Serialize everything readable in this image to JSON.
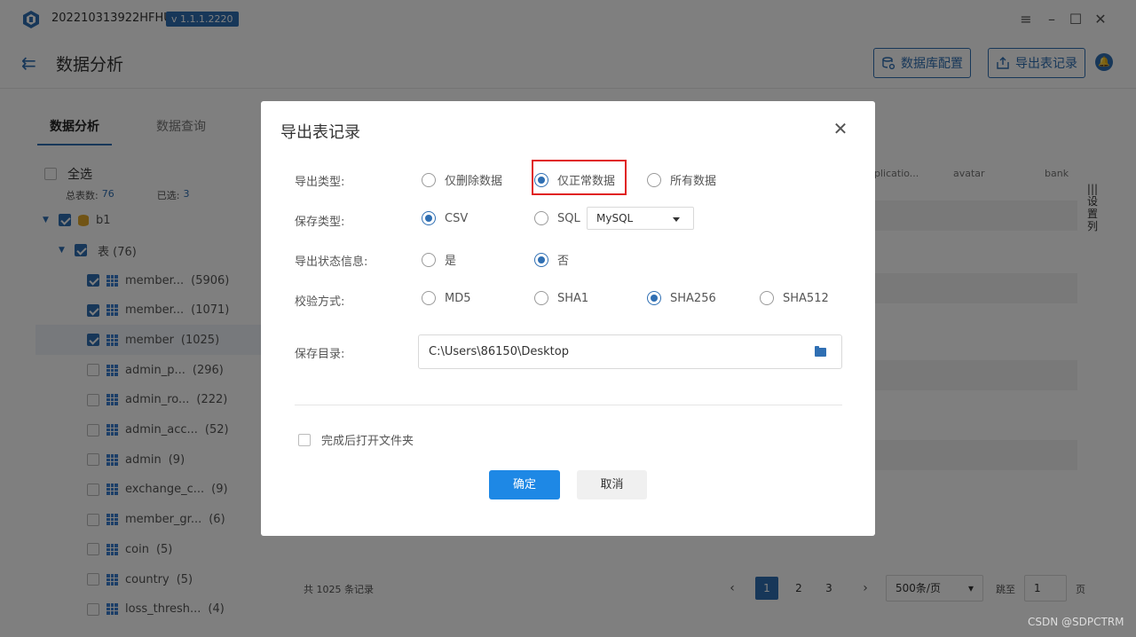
{
  "titlebar": {
    "app_name": "202210313922HFHU",
    "version": "v 1.1.1.2220",
    "menu_icon": "hamburger-icon",
    "minimize_icon": "minimize-icon",
    "maximize_icon": "maximize-icon",
    "close_icon": "close-icon"
  },
  "header": {
    "title": "数据分析",
    "db_config_label": "数据库配置",
    "export_records_label": "导出表记录"
  },
  "left": {
    "tabs": [
      {
        "label": "数据分析"
      },
      {
        "label": "数据查询"
      }
    ],
    "select_all": "全选",
    "total_label": "总表数:",
    "total_value": "76",
    "selected_label": "已选:",
    "selected_value": "3",
    "db_name": "b1",
    "table_group": "表 (76)",
    "tables": [
      {
        "name": "member...",
        "count": "(5906)",
        "checked": true
      },
      {
        "name": "member...",
        "count": "(1071)",
        "checked": true
      },
      {
        "name": "member",
        "count": "(1025)",
        "checked": true
      },
      {
        "name": "admin_p...",
        "count": "(296)",
        "checked": false
      },
      {
        "name": "admin_ro...",
        "count": "(222)",
        "checked": false
      },
      {
        "name": "admin_acc...",
        "count": "(52)",
        "checked": false
      },
      {
        "name": "admin",
        "count": "(9)",
        "checked": false
      },
      {
        "name": "exchange_c...",
        "count": "(9)",
        "checked": false
      },
      {
        "name": "member_gr...",
        "count": "(6)",
        "checked": false
      },
      {
        "name": "coin",
        "count": "(5)",
        "checked": false
      },
      {
        "name": "country",
        "count": "(5)",
        "checked": false
      },
      {
        "name": "loss_thresh...",
        "count": "(4)",
        "checked": false
      }
    ]
  },
  "right": {
    "col_heads": [
      "plicatio...",
      "avatar",
      "bank"
    ],
    "settings_col": "设置列",
    "total_prefix": "共",
    "total_count": "1025",
    "total_suffix": "条记录",
    "pages": [
      "1",
      "2",
      "3"
    ],
    "page_size": "500条/页",
    "goto_label": "跳至",
    "goto_value": "1",
    "goto_unit": "页"
  },
  "modal": {
    "title": "导出表记录",
    "export_type_label": "导出类型:",
    "export_type_options": [
      "仅删除数据",
      "仅正常数据",
      "所有数据"
    ],
    "export_type_selected": "仅正常数据",
    "save_type_label": "保存类型:",
    "save_type_options": [
      "CSV",
      "SQL"
    ],
    "save_type_selected": "CSV",
    "sql_dialect": "MySQL",
    "export_status_label": "导出状态信息:",
    "export_status_options": [
      "是",
      "否"
    ],
    "export_status_selected": "否",
    "checksum_label": "校验方式:",
    "checksum_options": [
      "MD5",
      "SHA1",
      "SHA256",
      "SHA512"
    ],
    "checksum_selected": "SHA256",
    "save_dir_label": "保存目录:",
    "save_dir_value": "C:\\Users\\86150\\Desktop",
    "open_folder_label": "完成后打开文件夹",
    "ok_label": "确定",
    "cancel_label": "取消"
  },
  "watermark": "CSDN @SDPCTRM",
  "colors": {
    "accent": "#2f6fb3",
    "primary_button": "#1e88e5",
    "highlight": "#e02020"
  }
}
